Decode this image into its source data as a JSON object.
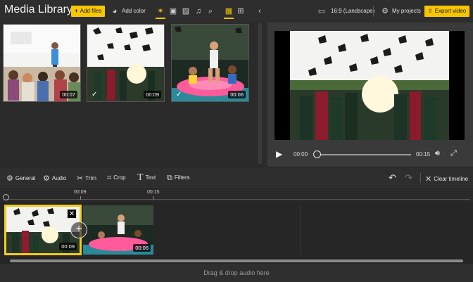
{
  "header": {
    "title": "Media Library",
    "add_files": "Add files",
    "add_color": "Add color",
    "aspect": "16:9 (Landscape)",
    "my_projects": "My projects",
    "export": "Export video"
  },
  "filter_icons": [
    "star-icon",
    "video-icon",
    "image-icon",
    "music-icon",
    "search-icon"
  ],
  "library": {
    "items": [
      {
        "duration": "00:07",
        "checked": false
      },
      {
        "duration": "00:09",
        "checked": true
      },
      {
        "duration": "00:06",
        "checked": true
      }
    ]
  },
  "player": {
    "current": "00:00",
    "total": "00:15"
  },
  "edit_tools": {
    "general": "General",
    "audio": "Audio",
    "trim": "Trim",
    "crop": "Crop",
    "text": "Text",
    "filters": "Filters",
    "clear": "Clear timeline"
  },
  "timeline": {
    "ticks": [
      "00:09",
      "00:15"
    ],
    "clips": [
      {
        "duration": "00:09"
      },
      {
        "duration": "00:06"
      }
    ],
    "audio_hint": "Drag & drop audio here"
  },
  "colors": {
    "accent": "#f7c600",
    "panel": "#2b2b2b"
  }
}
